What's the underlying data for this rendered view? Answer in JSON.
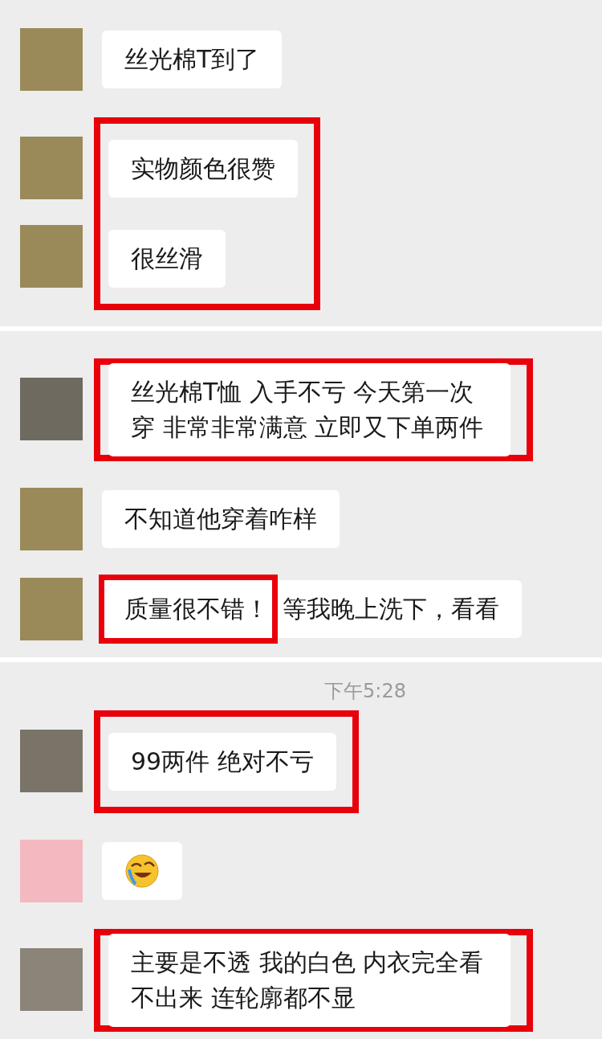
{
  "sections": [
    {
      "blocks": [
        {
          "kind": "message",
          "color": "#9a8a5a",
          "text": "丝光棉T到了"
        },
        {
          "kind": "highlight",
          "messages": [
            {
              "color": "#9a8a5a",
              "text": "实物颜色很赞"
            },
            {
              "color": "#9a8a5a",
              "text": "很丝滑"
            }
          ]
        }
      ]
    },
    {
      "blocks": [
        {
          "kind": "highlight",
          "messages": [
            {
              "color": "#6f6a60",
              "text": "丝光棉T恤 入手不亏 今天第一次穿 非常非常满意 立即又下单两件"
            }
          ]
        },
        {
          "kind": "message",
          "color": "#9a8a5a",
          "text": "不知道他穿着咋样"
        },
        {
          "kind": "partial",
          "color": "#9a8a5a",
          "marked": "质量很不错！",
          "text": "等我晚上洗下，看看"
        }
      ]
    },
    {
      "blocks": [
        {
          "kind": "time",
          "text": "下午5:28"
        },
        {
          "kind": "highlight",
          "messages": [
            {
              "color": "#7a7368",
              "text": "99两件 绝对不亏"
            }
          ]
        },
        {
          "kind": "sticker",
          "color": "#f3b8c0"
        },
        {
          "kind": "highlight",
          "messages": [
            {
              "color": "#8a8578",
              "text": "主要是不透 我的白色 内衣完全看不出来 连轮廓都不显"
            }
          ]
        }
      ]
    }
  ]
}
